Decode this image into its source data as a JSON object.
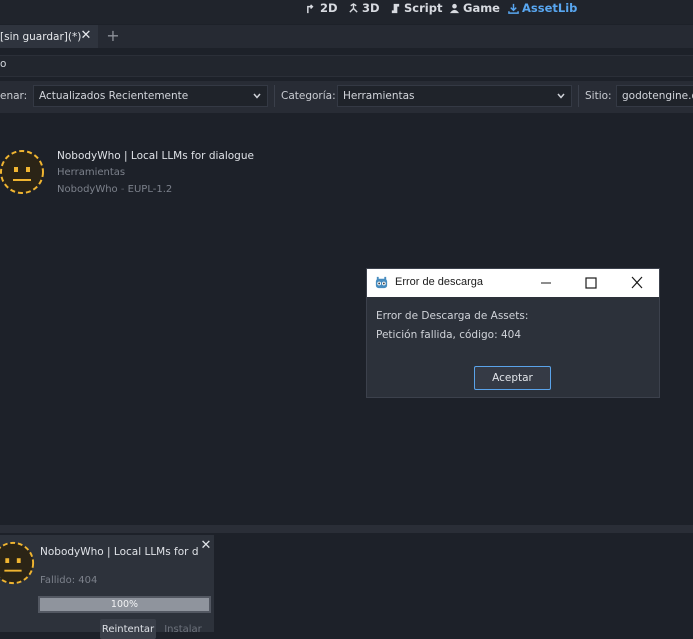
{
  "main_screens": [
    {
      "label": "2D",
      "icon": "2d-icon"
    },
    {
      "label": "3D",
      "icon": "3d-icon"
    },
    {
      "label": "Script",
      "icon": "script-icon"
    },
    {
      "label": "Game",
      "icon": "game-icon"
    },
    {
      "label": "AssetLib",
      "icon": "assetlib-icon",
      "active": true
    }
  ],
  "scene_tab": {
    "label": "[sin guardar](*)",
    "close": "✕",
    "add": "+"
  },
  "search": {
    "value": "o"
  },
  "filters": {
    "sort_label": "enar:",
    "sort_value": "Actualizados Recientemente",
    "category_label": "Categoría:",
    "category_value": "Herramientas",
    "site_label": "Sitio:",
    "site_value": "godotengine.or"
  },
  "asset": {
    "title": "NobodyWho | Local LLMs for dialogue",
    "category": "Herramientas",
    "author": "NobodyWho",
    "license": "EUPL-1.2",
    "separator": " - "
  },
  "dialog": {
    "title": "Error de descarga",
    "message_line1": "Error de Descarga de Assets:",
    "message_line2": "Petición fallida, código: 404",
    "ok_label": "Aceptar"
  },
  "download": {
    "title": "NobodyWho | Local LLMs for dial",
    "status": "Fallido: 404",
    "progress": 1.0,
    "progress_label": "100%",
    "retry_label": "Reintentar",
    "install_label": "Instalar",
    "close": "✕"
  },
  "colors": {
    "background": "#1d2129",
    "accent": "#58a6f0",
    "dialog_bg": "#2c313a",
    "icon_yellow": "#f0b531"
  }
}
